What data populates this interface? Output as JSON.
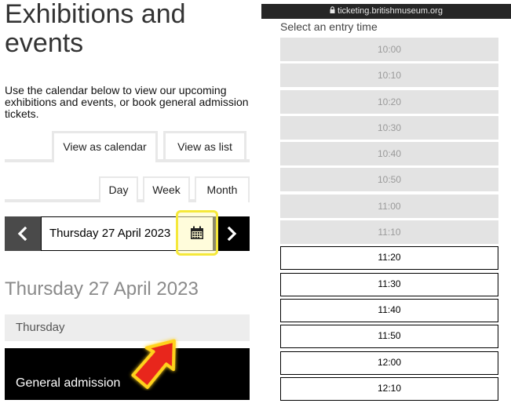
{
  "left": {
    "title": "Exhibitions and events",
    "intro": "Use the calendar below to view our upcoming exhibitions and events, or book general admission tickets.",
    "view_tabs": {
      "calendar": "View as calendar",
      "list": "View as list"
    },
    "range_tabs": {
      "day": "Day",
      "week": "Week",
      "month": "Month"
    },
    "date_field": "Thursday 27 April 2023",
    "big_date": "Thursday 27 April 2023",
    "day_label": "Thursday",
    "event_label": "General admission",
    "highlight_color": "#f5e83a",
    "arrow_color": "#e8261a"
  },
  "right": {
    "url": "ticketing.britishmuseum.org",
    "heading": "Select an entry time",
    "slots": [
      {
        "time": "10:00",
        "available": false
      },
      {
        "time": "10:10",
        "available": false
      },
      {
        "time": "10:20",
        "available": false
      },
      {
        "time": "10:30",
        "available": false
      },
      {
        "time": "10:40",
        "available": false
      },
      {
        "time": "10:50",
        "available": false
      },
      {
        "time": "11:00",
        "available": false
      },
      {
        "time": "11:10",
        "available": false
      },
      {
        "time": "11:20",
        "available": true
      },
      {
        "time": "11:30",
        "available": true
      },
      {
        "time": "11:40",
        "available": true
      },
      {
        "time": "11:50",
        "available": true
      },
      {
        "time": "12:00",
        "available": true
      },
      {
        "time": "12:10",
        "available": true
      }
    ]
  }
}
